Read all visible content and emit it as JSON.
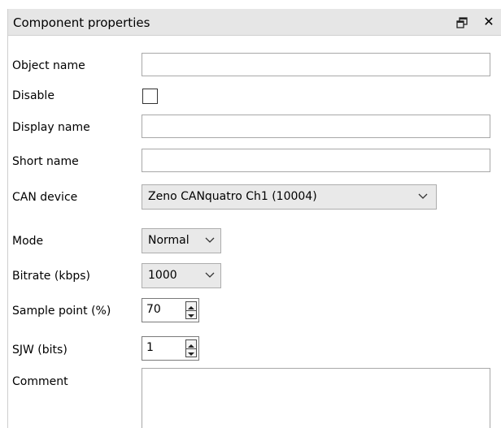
{
  "panel": {
    "title": "Component properties",
    "float_icon": "float-window-icon",
    "close_icon": "close-icon",
    "close_glyph": "✕"
  },
  "fields": {
    "object_name": {
      "label": "Object name",
      "value": ""
    },
    "disable": {
      "label": "Disable",
      "checked": false
    },
    "display_name": {
      "label": "Display name",
      "value": ""
    },
    "short_name": {
      "label": "Short name",
      "value": ""
    },
    "can_device": {
      "label": "CAN device",
      "value": "Zeno CANquatro Ch1 (10004)"
    },
    "mode": {
      "label": "Mode",
      "value": "Normal"
    },
    "bitrate": {
      "label": "Bitrate (kbps)",
      "value": "1000"
    },
    "sample_point": {
      "label": "Sample point (%)",
      "value": "70"
    },
    "sjw": {
      "label": "SJW (bits)",
      "value": "1"
    },
    "comment": {
      "label": "Comment",
      "value": ""
    }
  },
  "colors": {
    "titlebar": "#e6e6e6",
    "combo_bg": "#e9e9e9",
    "border": "#a8a8a8"
  }
}
